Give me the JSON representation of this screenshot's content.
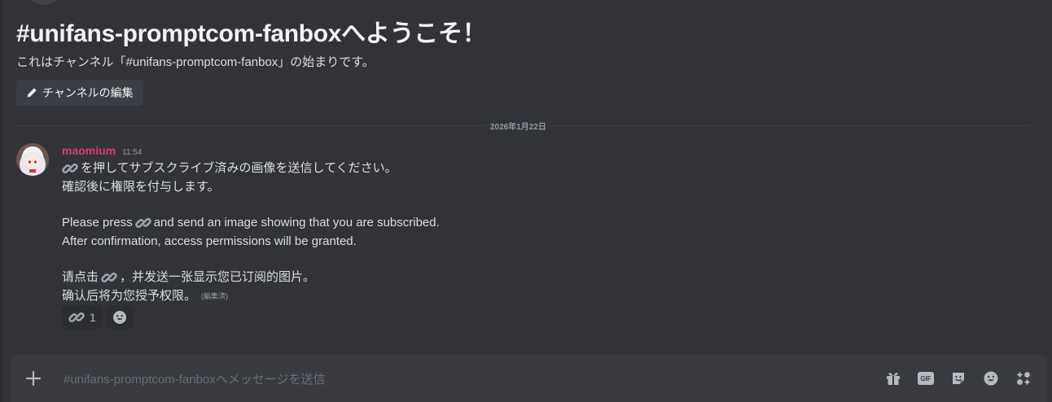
{
  "channel": {
    "welcome_title": "#unifans-promptcom-fanboxへようこそ！",
    "welcome_subtitle": "これはチャンネル「#unifans-promptcom-fanbox」の始まりです。",
    "edit_button_label": "チャンネルの編集"
  },
  "divider": {
    "date": "2026年1月22日"
  },
  "message": {
    "username": "maomium",
    "time": "11:54",
    "jp_line1": "を押してサブスクライブ済みの画像を送信してください。",
    "jp_line2": "確認後に権限を付与します。",
    "en_line1_pre": "Please press",
    "en_line1_post": "and send an image showing that you are subscribed.",
    "en_line2": "After confirmation, access permissions will be granted.",
    "zh_line1_pre": "请点击",
    "zh_line1_post": "，并发送一张显示您已订阅的图片。",
    "zh_line2": "确认后将为您授予权限。",
    "edited_label": "(編集済)",
    "link_emoji_icon": "link-emoji-icon"
  },
  "reactions": [
    {
      "emoji": "link-emoji-icon",
      "count": "1"
    }
  ],
  "composer": {
    "placeholder": "#unifans-promptcom-fanboxへメッセージを送信",
    "gif_label": "GIF"
  },
  "colors": {
    "background": "#313338",
    "composer": "#383a40",
    "username": "#e13a6b",
    "muted": "#949ba4"
  }
}
